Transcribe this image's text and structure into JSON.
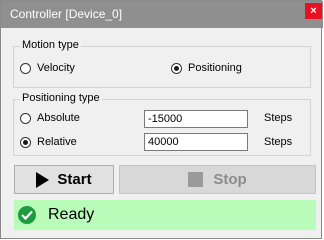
{
  "window": {
    "title": "Controller [Device_0]",
    "close_glyph": "×"
  },
  "motion": {
    "legend": "Motion type",
    "velocity_label": "Velocity",
    "positioning_label": "Positioning",
    "selected": "Positioning"
  },
  "positioning": {
    "legend": "Positioning type",
    "absolute_label": "Absolute",
    "relative_label": "Relative",
    "selected": "Relative",
    "absolute_value": "-15000",
    "relative_value": "40000",
    "absolute_unit": "Steps",
    "relative_unit": "Steps"
  },
  "buttons": {
    "start_label": "Start",
    "stop_label": "Stop",
    "start_icon": "play-icon",
    "stop_icon": "stop-icon"
  },
  "status": {
    "text": "Ready",
    "icon": "check-circle-icon",
    "background": "#b9fbb9",
    "icon_color": "#1c9b3f"
  }
}
